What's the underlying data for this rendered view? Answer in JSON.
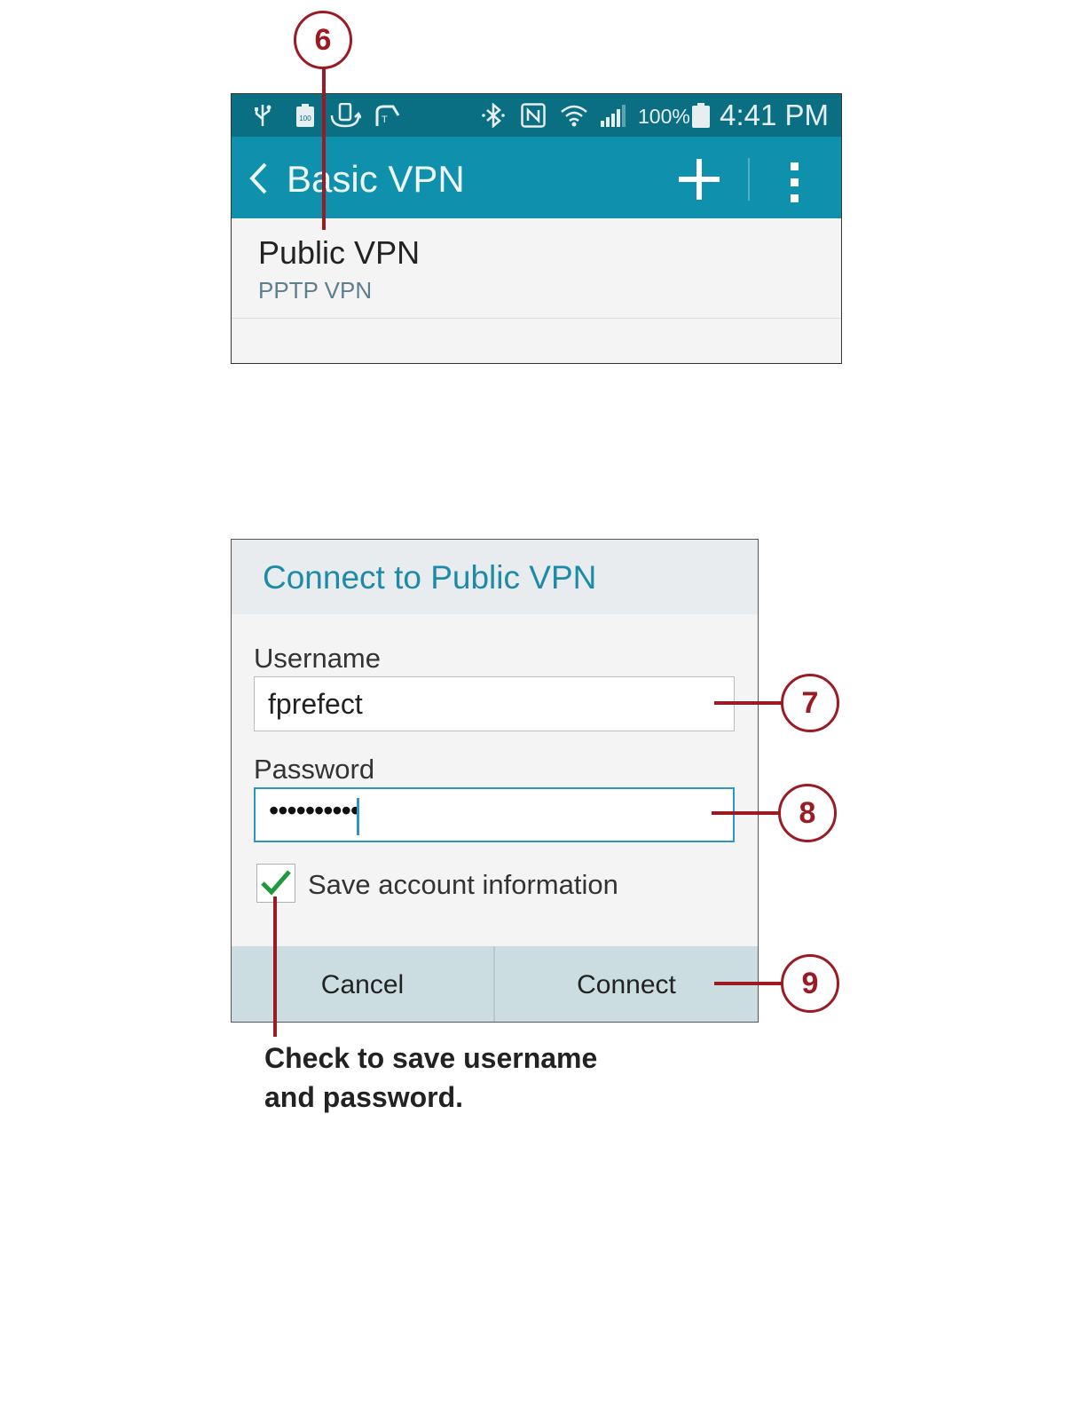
{
  "screen1": {
    "status_bar": {
      "battery_percent": "100%",
      "time": "4:41 PM",
      "icons": [
        "usb-icon",
        "battery-100-icon",
        "sync-icon",
        "tmobile-icon",
        "bluetooth-icon",
        "nfc-icon",
        "wifi-icon",
        "signal-icon",
        "battery-icon"
      ]
    },
    "action_bar": {
      "title": "Basic VPN",
      "icons": [
        "back-icon",
        "add-icon",
        "overflow-menu-icon"
      ]
    },
    "list": [
      {
        "title": "Public VPN",
        "subtitle": "PPTP VPN"
      }
    ]
  },
  "dialog": {
    "title": "Connect to Public VPN",
    "username_label": "Username",
    "username_value": "fprefect",
    "password_label": "Password",
    "password_value": "••••••••••",
    "save_checkbox_label": "Save account information",
    "save_checked": true,
    "cancel_label": "Cancel",
    "connect_label": "Connect"
  },
  "callouts": {
    "c6": "6",
    "c7": "7",
    "c8": "8",
    "c9": "9"
  },
  "caption": {
    "line1": "Check to save username",
    "line2": "and password."
  },
  "colors": {
    "status_bar": "#0b6f83",
    "action_bar": "#0f91ad",
    "accent": "#1d8ba7",
    "callout": "#9b1b24",
    "checkmark": "#1f9a3a"
  }
}
